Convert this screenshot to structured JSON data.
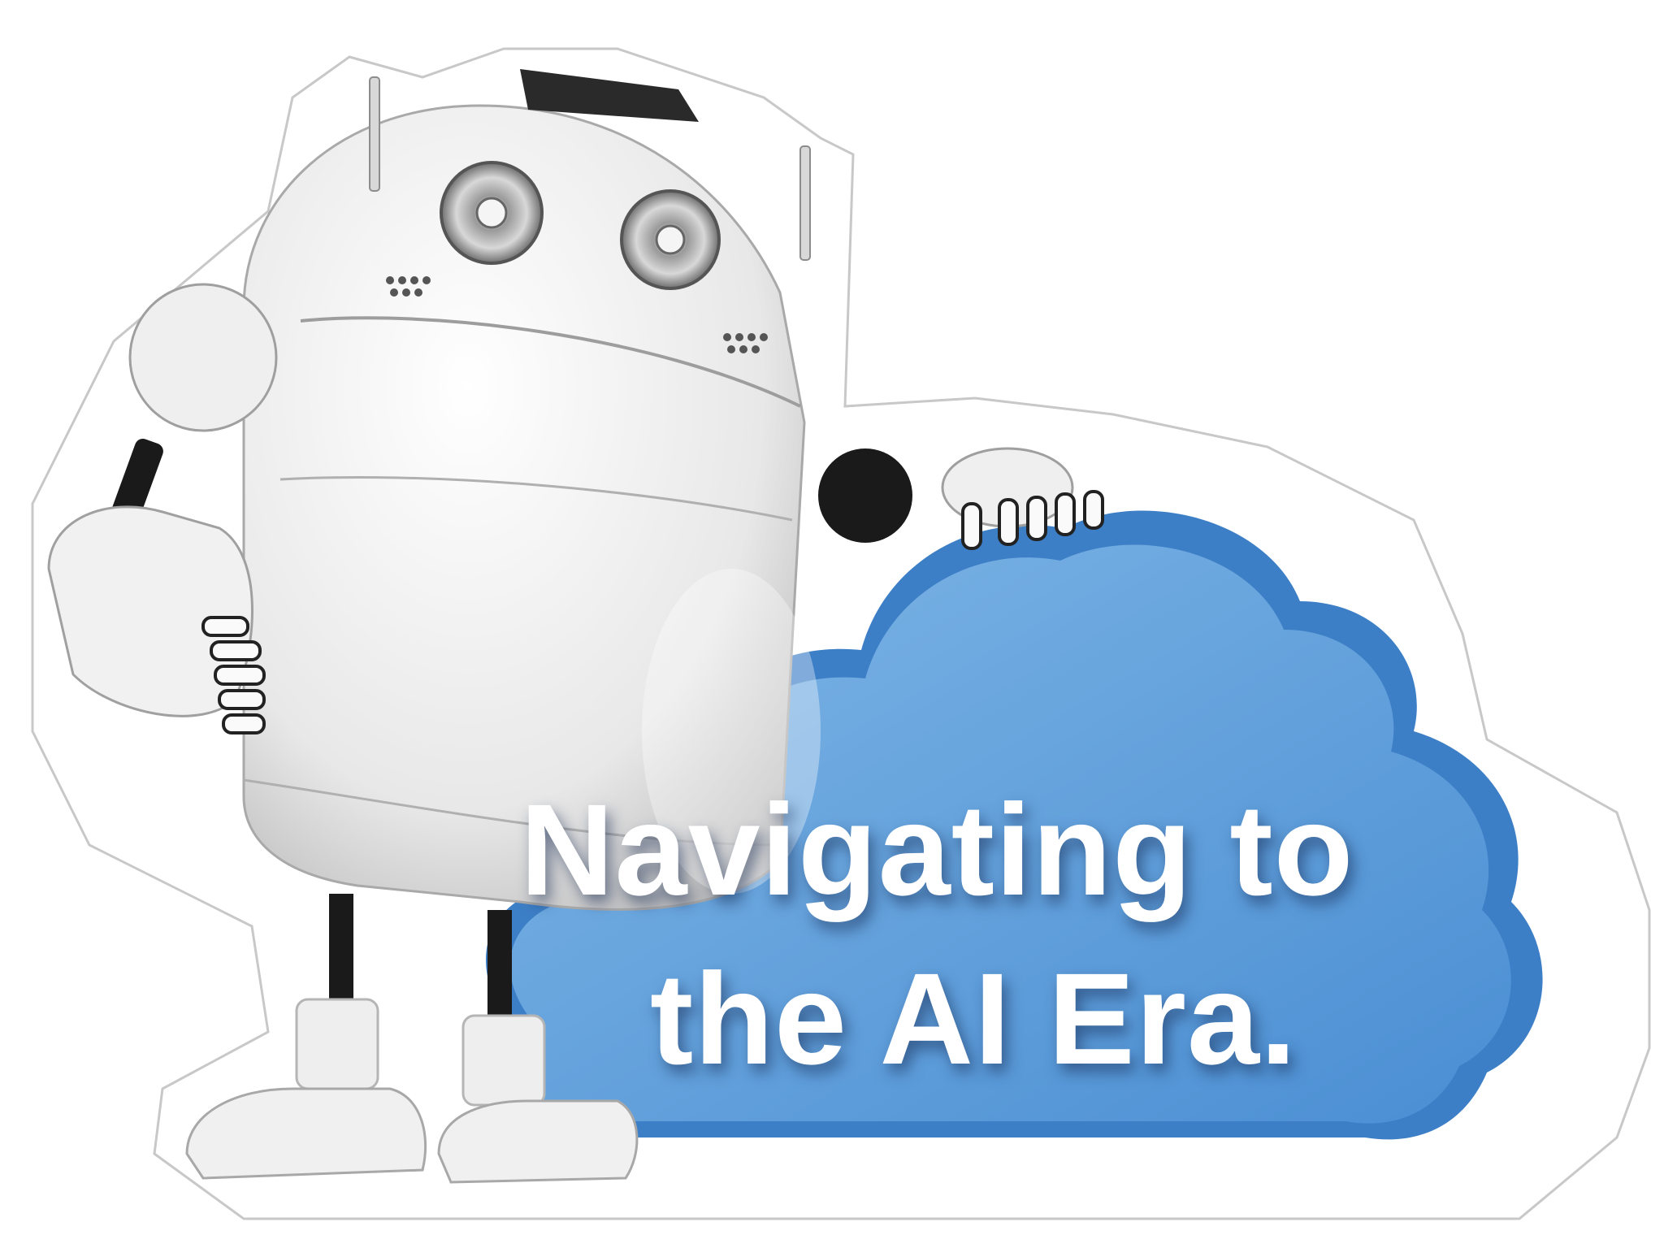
{
  "headline": {
    "line1": "Navigating to",
    "line2": "the AI Era."
  },
  "colors": {
    "cloud": "#5f9fd9",
    "cloud_edge": "#3d7fc6",
    "robot_body": "#f2f2f2",
    "joints": "#1a1a1a",
    "text": "#ffffff",
    "sticker_outline": "#c8c8c8"
  },
  "icons": {
    "robot": "robot-illustration",
    "cloud": "cloud-shape"
  }
}
